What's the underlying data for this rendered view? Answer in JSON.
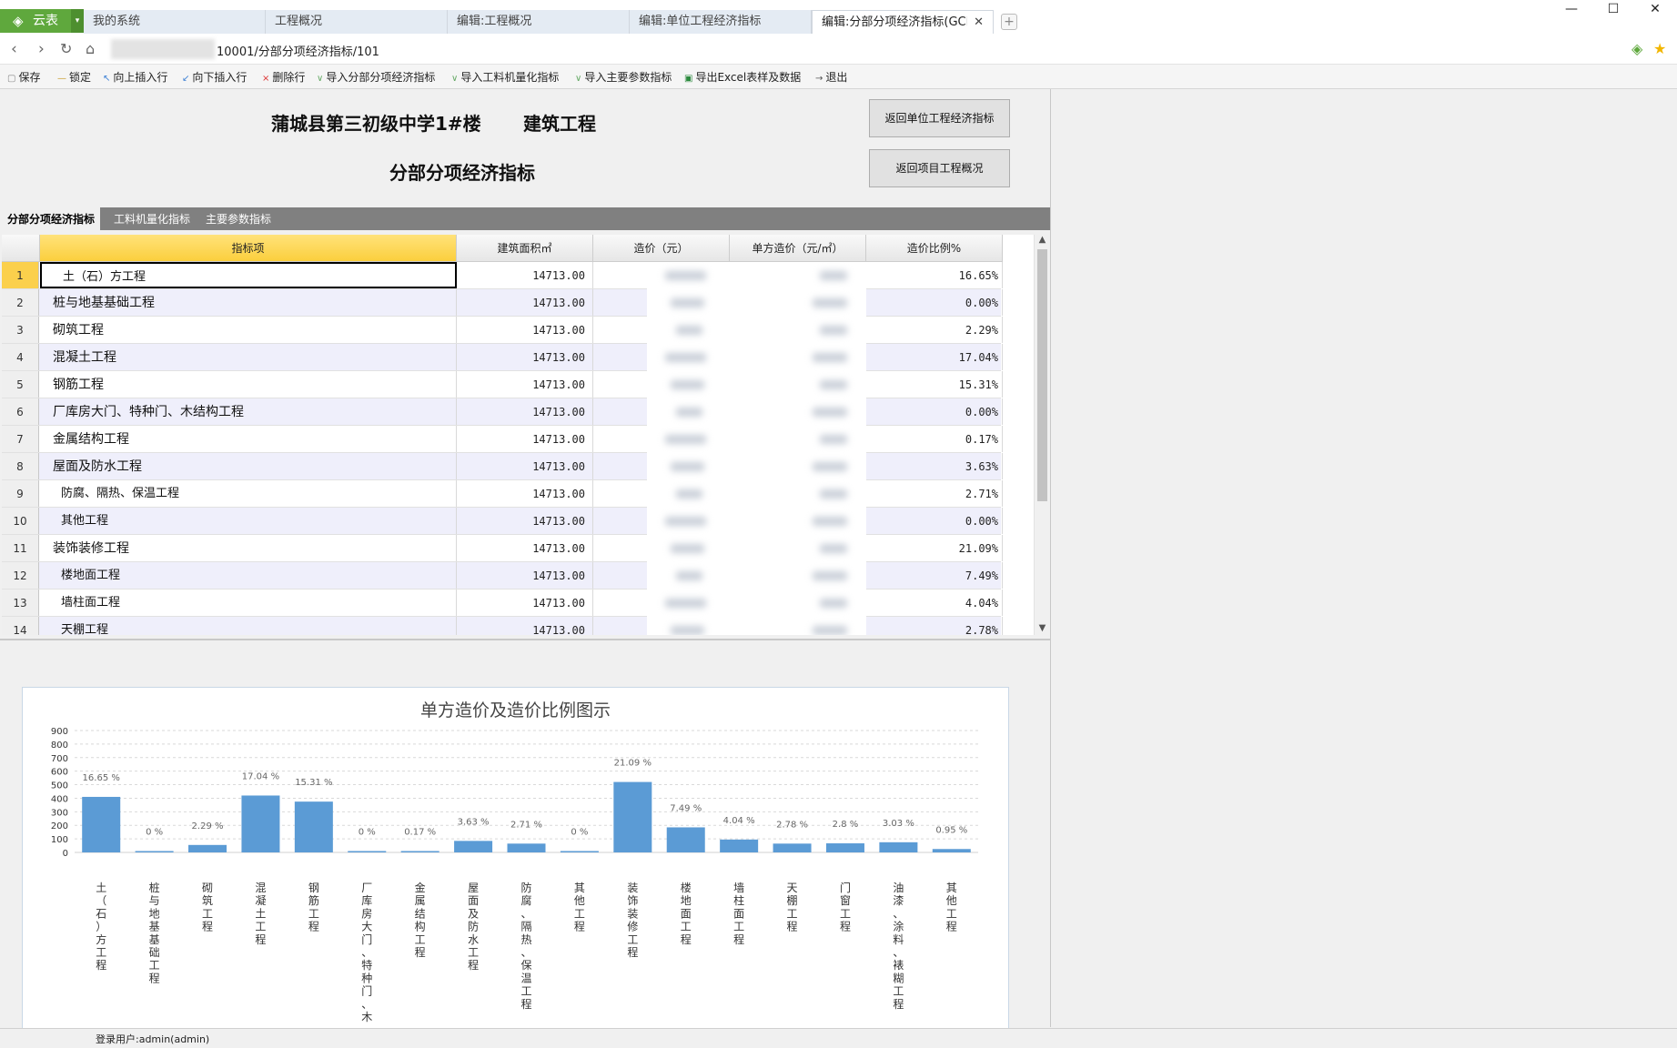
{
  "browser": {
    "brand_label": "云表",
    "tabs": [
      "我的系统",
      "工程概况",
      "编辑:工程概况",
      "编辑:单位工程经济指标",
      "编辑:分部分项经济指标(GCBH"
    ],
    "url_visible": "10001/分部分项经济指标/101"
  },
  "toolbar": {
    "items": [
      "保存",
      "锁定",
      "向上插入行",
      "向下插入行",
      "删除行",
      "导入分部分项经济指标",
      "导入工料机量化指标",
      "导入主要参数指标",
      "导出Excel表样及数据",
      "退出"
    ]
  },
  "header": {
    "project_name": "蒲城县第三初级中学1#楼",
    "discipline": "建筑工程",
    "subtitle": "分部分项经济指标",
    "btn_back_unit": "返回单位工程经济指标",
    "btn_back_project": "返回项目工程概况"
  },
  "subtabs": [
    "分部分项经济指标",
    "工料机量化指标",
    "主要参数指标"
  ],
  "table": {
    "columns": [
      "指标项",
      "建筑面积㎡",
      "造价（元）",
      "单方造价（元/㎡）",
      "造价比例%"
    ],
    "rows": [
      {
        "no": "1",
        "name": "土（石）方工程",
        "area": "14713.00",
        "ratio": "16.65%"
      },
      {
        "no": "2",
        "name": "桩与地基基础工程",
        "area": "14713.00",
        "ratio": "0.00%"
      },
      {
        "no": "3",
        "name": "砌筑工程",
        "area": "14713.00",
        "ratio": "2.29%"
      },
      {
        "no": "4",
        "name": "混凝土工程",
        "area": "14713.00",
        "ratio": "17.04%"
      },
      {
        "no": "5",
        "name": "钢筋工程",
        "area": "14713.00",
        "ratio": "15.31%"
      },
      {
        "no": "6",
        "name": "厂库房大门、特种门、木结构工程",
        "area": "14713.00",
        "ratio": "0.00%"
      },
      {
        "no": "7",
        "name": "金属结构工程",
        "area": "14713.00",
        "ratio": "0.17%"
      },
      {
        "no": "8",
        "name": "屋面及防水工程",
        "area": "14713.00",
        "ratio": "3.63%"
      },
      {
        "no": "9",
        "name": "防腐、隔热、保温工程",
        "area": "14713.00",
        "ratio": "2.71%"
      },
      {
        "no": "10",
        "name": "其他工程",
        "area": "14713.00",
        "ratio": "0.00%"
      },
      {
        "no": "11",
        "name": "装饰装修工程",
        "area": "14713.00",
        "ratio": "21.09%"
      },
      {
        "no": "12",
        "name": "楼地面工程",
        "area": "14713.00",
        "ratio": "7.49%"
      },
      {
        "no": "13",
        "name": "墙柱面工程",
        "area": "14713.00",
        "ratio": "4.04%"
      },
      {
        "no": "14",
        "name": "天棚工程",
        "area": "14713.00",
        "ratio": "2.78%"
      }
    ]
  },
  "chart_data": {
    "type": "bar",
    "title": "单方造价及造价比例图示",
    "categories": [
      "土（石）方工程",
      "桩与地基基础工程",
      "砌筑工程",
      "混凝土工程",
      "钢筋工程",
      "厂库房大门、特种门、木",
      "金属结构工程",
      "屋面及防水工程",
      "防腐、隔热、保温工程",
      "其他工程",
      "装饰装修工程",
      "楼地面工程",
      "墙柱面工程",
      "天棚工程",
      "门窗工程",
      "油漆、涂料、裱糊工程",
      "其他工程"
    ],
    "values": [
      410,
      0,
      55,
      420,
      375,
      0,
      5,
      85,
      65,
      0,
      520,
      185,
      95,
      65,
      67,
      75,
      25
    ],
    "data_labels": [
      "16.65 %",
      "0 %",
      "2.29 %",
      "17.04 %",
      "15.31 %",
      "0 %",
      "0.17 %",
      "3.63 %",
      "2.71 %",
      "0 %",
      "21.09 %",
      "7.49 %",
      "4.04 %",
      "2.78 %",
      "2.8 %",
      "3.03 %",
      "0.95 %"
    ],
    "ylim": [
      0,
      900
    ],
    "yticks": [
      0,
      100,
      200,
      300,
      400,
      500,
      600,
      700,
      800,
      900
    ],
    "grid": true,
    "bar_color": "#5b9bd5"
  },
  "status": {
    "login_text": "登录用户:admin(admin)"
  },
  "colors": {
    "brand_green": "#5fa83d",
    "selected_header": "#fbcf3d",
    "alt_row": "#efeffb"
  }
}
